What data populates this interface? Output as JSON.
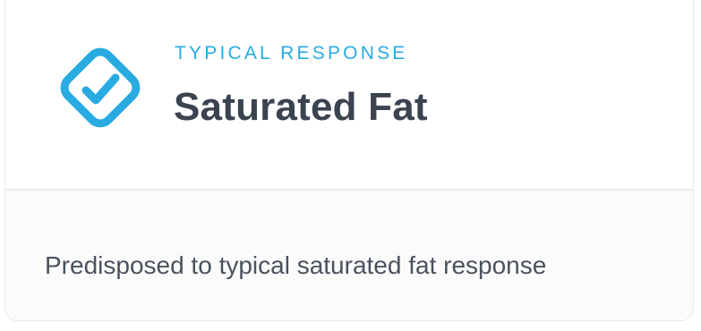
{
  "card": {
    "status_label": "TYPICAL RESPONSE",
    "title": "Saturated Fat",
    "description": "Predisposed to typical saturated fat response",
    "icon": "check-diamond-icon",
    "accent_color": "#29abe2"
  }
}
